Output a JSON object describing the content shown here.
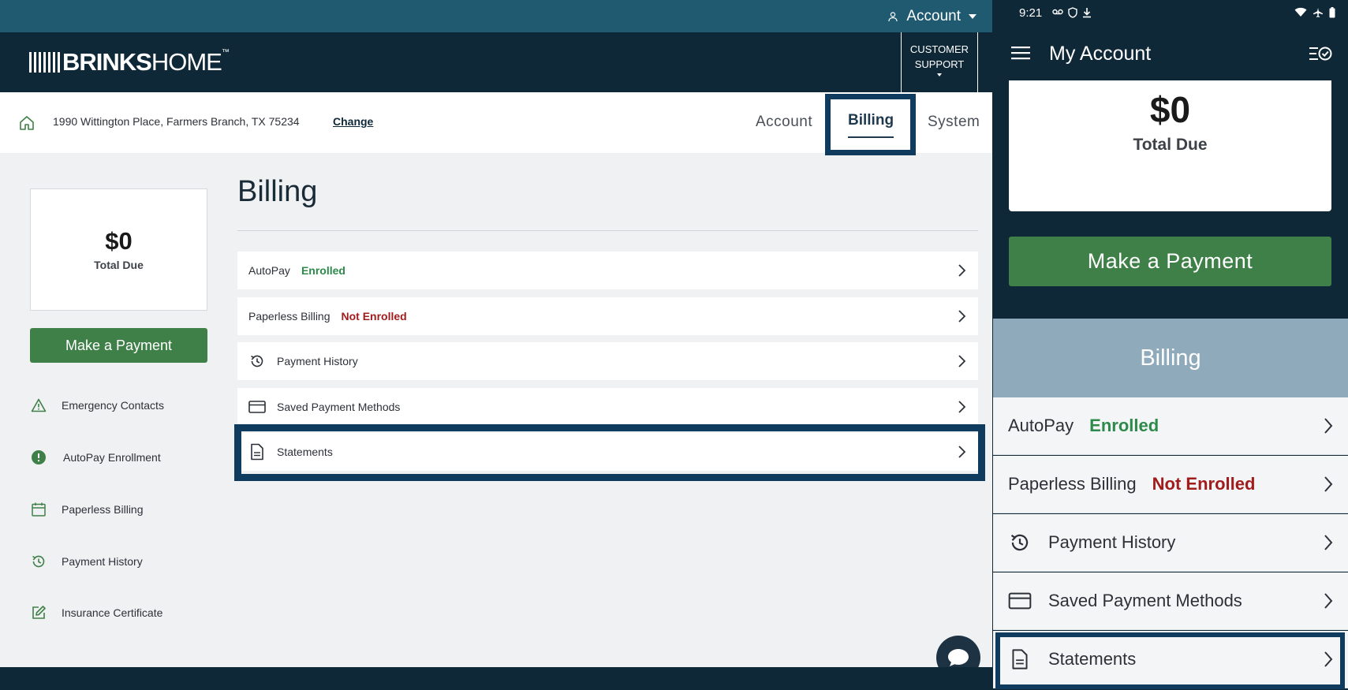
{
  "desktop": {
    "account_menu": "Account",
    "logo": {
      "brand_bold": "BRINKS",
      "brand_light": "HOME",
      "tm": "™"
    },
    "support": {
      "line1": "CUSTOMER",
      "line2": "SUPPORT"
    },
    "address": "1990 Wittington Place, Farmers Branch, TX 75234",
    "change_link": "Change",
    "tabs": [
      "Account",
      "Billing",
      "System"
    ],
    "total_due": {
      "amount": "$0",
      "label": "Total Due"
    },
    "make_payment": "Make a Payment",
    "sidebar": [
      {
        "label": "Emergency Contacts",
        "icon": "warning-triangle-icon"
      },
      {
        "label": "AutoPay Enrollment",
        "icon": "alert-circle-icon"
      },
      {
        "label": "Paperless Billing",
        "icon": "calendar-icon"
      },
      {
        "label": "Payment History",
        "icon": "history-icon"
      },
      {
        "label": "Insurance Certificate",
        "icon": "edit-icon"
      }
    ],
    "page_title": "Billing",
    "rows": [
      {
        "label": "AutoPay",
        "status": "Enrolled"
      },
      {
        "label": "Paperless Billing",
        "status": "Not Enrolled"
      },
      {
        "label": "Payment History",
        "icon": "history-icon"
      },
      {
        "label": "Saved Payment Methods",
        "icon": "credit-card-icon"
      },
      {
        "label": "Statements",
        "icon": "document-icon"
      }
    ]
  },
  "mobile": {
    "status_time": "9:21",
    "header_title": "My Account",
    "total_due": {
      "amount": "$0",
      "label": "Total Due"
    },
    "make_payment": "Make a Payment",
    "section_title": "Billing",
    "rows": [
      {
        "label": "AutoPay",
        "status": "Enrolled"
      },
      {
        "label": "Paperless Billing",
        "status": "Not Enrolled"
      },
      {
        "label": "Payment History",
        "icon": "history-icon"
      },
      {
        "label": "Saved Payment Methods",
        "icon": "credit-card-icon"
      },
      {
        "label": "Statements",
        "icon": "document-icon"
      }
    ]
  },
  "colors": {
    "navy": "#0f2838",
    "teal_bar": "#1f5a70",
    "green": "#3f8048",
    "enrolled": "#2d8a4a",
    "not_enrolled": "#a11c1c",
    "highlight": "#0f3b5f"
  }
}
